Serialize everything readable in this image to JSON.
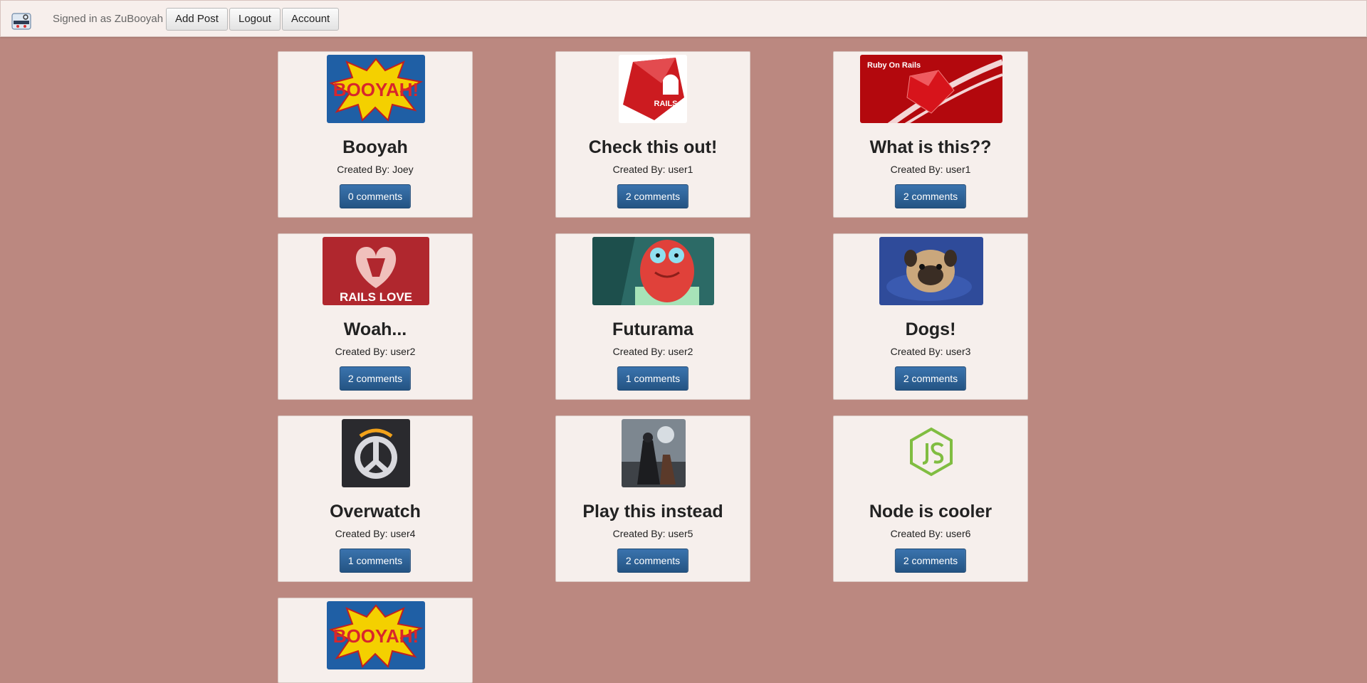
{
  "header": {
    "user_label": "Signed in as ZuBooyah",
    "add_post": "Add Post",
    "logout": "Logout",
    "account": "Account"
  },
  "posts": [
    {
      "title": "Booyah",
      "author": "Created By: Joey",
      "comments": "0 comments"
    },
    {
      "title": "Check this out!",
      "author": "Created By: user1",
      "comments": "2 comments"
    },
    {
      "title": "What is this??",
      "author": "Created By: user1",
      "comments": "2 comments",
      "image_text": "Ruby On Rails"
    },
    {
      "title": "Woah...",
      "author": "Created By: user2",
      "comments": "2 comments",
      "image_text": "RAILS LOVE"
    },
    {
      "title": "Futurama",
      "author": "Created By: user2",
      "comments": "1 comments"
    },
    {
      "title": "Dogs!",
      "author": "Created By: user3",
      "comments": "2 comments"
    },
    {
      "title": "Overwatch",
      "author": "Created By: user4",
      "comments": "1 comments"
    },
    {
      "title": "Play this instead",
      "author": "Created By: user5",
      "comments": "2 comments"
    },
    {
      "title": "Node is cooler",
      "author": "Created By: user6",
      "comments": "2 comments"
    },
    {
      "title": "",
      "author": "",
      "comments": ""
    }
  ],
  "colors": {
    "page_background": "#bb8880",
    "card_background": "#f6efec",
    "primary_button": "#2a5f96"
  }
}
